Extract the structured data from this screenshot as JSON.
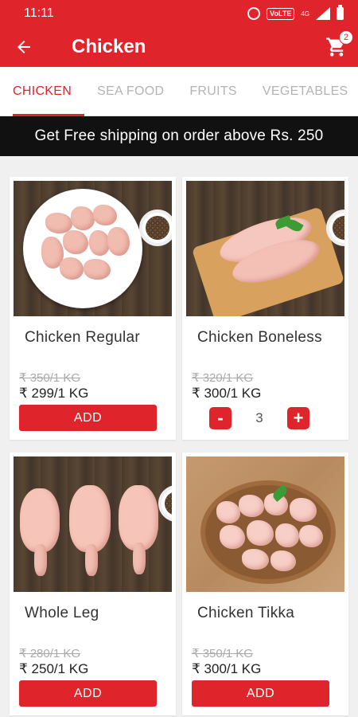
{
  "status_bar": {
    "time": "11:11",
    "volte_label": "VoLTE",
    "network_label": "4G"
  },
  "app_bar": {
    "title": "Chicken",
    "cart_count": "2",
    "accent_color": "#e0242b"
  },
  "tabs": [
    {
      "label": "CHICKEN",
      "active": true
    },
    {
      "label": "SEA FOOD",
      "active": false
    },
    {
      "label": "FRUITS",
      "active": false
    },
    {
      "label": "VEGETABLES",
      "active": false
    }
  ],
  "banner": {
    "text": "Get Free shipping on order above Rs. 250"
  },
  "products": [
    {
      "name": "Chicken Regular",
      "old_price": "₹ 350/1 KG",
      "price": "₹ 299/1 KG",
      "action": "ADD"
    },
    {
      "name": "Chicken Boneless",
      "old_price": "₹ 320/1 KG",
      "price": "₹ 300/1 KG",
      "quantity": "3",
      "minus": "-",
      "plus": "+"
    },
    {
      "name": "Whole Leg",
      "old_price": "₹ 280/1 KG",
      "price": "₹ 250/1 KG",
      "action": "ADD"
    },
    {
      "name": "Chicken Tikka",
      "old_price": "₹ 350/1 KG",
      "price": "₹ 300/1 KG",
      "action": "ADD"
    }
  ]
}
